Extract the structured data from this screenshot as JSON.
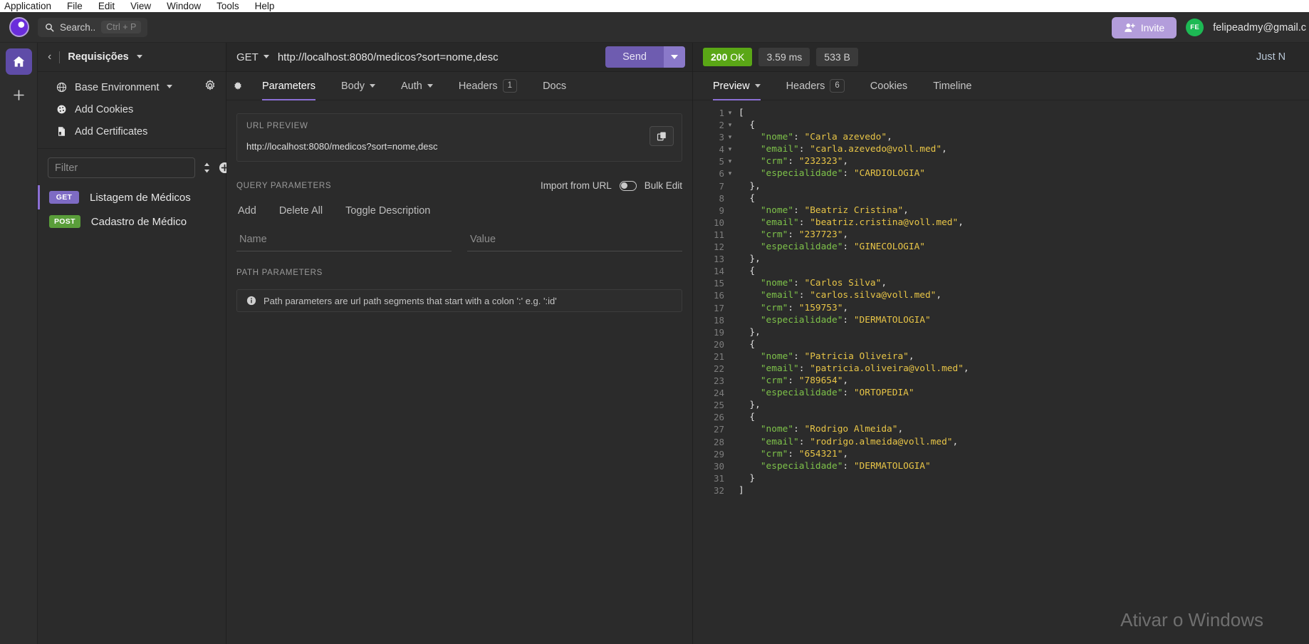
{
  "os_menu": [
    "Application",
    "File",
    "Edit",
    "View",
    "Window",
    "Tools",
    "Help"
  ],
  "header": {
    "logo_name": "insomnia-logo",
    "search": {
      "label": "Search..",
      "shortcut": "Ctrl + P",
      "placeholder": "Search.."
    },
    "invite_label": "Invite",
    "avatar_initials": "FE",
    "account_email": "felipeadmy@gmail.c"
  },
  "activity_bar": [
    {
      "name": "home",
      "icon": "home-icon",
      "active": true
    },
    {
      "name": "add",
      "icon": "plus-icon",
      "active": false
    }
  ],
  "sidebar": {
    "back_label": "‹",
    "title": "Requisições",
    "environment": {
      "label": "Base Environment",
      "settings_icon": "gear-icon"
    },
    "links": [
      {
        "label": "Add Cookies",
        "icon": "cookie-icon"
      },
      {
        "label": "Add Certificates",
        "icon": "certificate-icon"
      }
    ],
    "filter_placeholder": "Filter",
    "filter_value": "",
    "sort_icon": "sort-icon",
    "add_icon": "plus-circle-icon",
    "requests": [
      {
        "method": "GET",
        "name": "Listagem de Médicos",
        "selected": true
      },
      {
        "method": "POST",
        "name": "Cadastro de Médico",
        "selected": false
      }
    ]
  },
  "request": {
    "method": "GET",
    "url": "http://localhost:8080/medicos?sort=nome,desc",
    "send_label": "Send",
    "tabs": [
      {
        "label": "Parameters",
        "active": true,
        "caret": false,
        "badge": null
      },
      {
        "label": "Body",
        "active": false,
        "caret": true,
        "badge": null
      },
      {
        "label": "Auth",
        "active": false,
        "caret": true,
        "badge": null
      },
      {
        "label": "Headers",
        "active": false,
        "caret": false,
        "badge": "1"
      },
      {
        "label": "Docs",
        "active": false,
        "caret": false,
        "badge": null
      }
    ],
    "url_preview": {
      "label": "URL PREVIEW",
      "value": "http://localhost:8080/medicos?sort=nome,desc",
      "copy_icon": "copy-icon"
    },
    "query_parameters": {
      "title": "QUERY PARAMETERS",
      "import_label": "Import from URL",
      "bulk_edit_label": "Bulk Edit",
      "actions": [
        "Add",
        "Delete All",
        "Toggle Description"
      ],
      "name_placeholder": "Name",
      "name_value": "",
      "value_placeholder": "Value",
      "value_value": ""
    },
    "path_parameters": {
      "title": "PATH PARAMETERS",
      "info": "Path parameters are url path segments that start with a colon ':' e.g. ':id'"
    }
  },
  "response": {
    "status_code": "200",
    "status_text": "OK",
    "time": "3.59 ms",
    "size": "533 B",
    "timestamp": "Just N",
    "tabs": [
      {
        "label": "Preview",
        "active": true,
        "caret": true,
        "badge": null
      },
      {
        "label": "Headers",
        "active": false,
        "caret": false,
        "badge": "6"
      },
      {
        "label": "Cookies",
        "active": false,
        "caret": false,
        "badge": null
      },
      {
        "label": "Timeline",
        "active": false,
        "caret": false,
        "badge": null
      }
    ],
    "body": [
      {
        "n": 1,
        "fold": true,
        "indent": 0,
        "text": "["
      },
      {
        "n": 2,
        "fold": true,
        "indent": 1,
        "text": "{"
      },
      {
        "n": 3,
        "fold": false,
        "indent": 2,
        "key": "nome",
        "value": "\"Carla azevedo\"",
        "comma": true
      },
      {
        "n": 4,
        "fold": false,
        "indent": 2,
        "key": "email",
        "value": "\"carla.azevedo@voll.med\"",
        "comma": true
      },
      {
        "n": 5,
        "fold": false,
        "indent": 2,
        "key": "crm",
        "value": "\"232323\"",
        "comma": true
      },
      {
        "n": 6,
        "fold": false,
        "indent": 2,
        "key": "especialidade",
        "value": "\"CARDIOLOGIA\"",
        "comma": false
      },
      {
        "n": 7,
        "fold": false,
        "indent": 1,
        "text": "},"
      },
      {
        "n": 8,
        "fold": true,
        "indent": 1,
        "text": "{"
      },
      {
        "n": 9,
        "fold": false,
        "indent": 2,
        "key": "nome",
        "value": "\"Beatriz Cristina\"",
        "comma": true
      },
      {
        "n": 10,
        "fold": false,
        "indent": 2,
        "key": "email",
        "value": "\"beatriz.cristina@voll.med\"",
        "comma": true
      },
      {
        "n": 11,
        "fold": false,
        "indent": 2,
        "key": "crm",
        "value": "\"237723\"",
        "comma": true
      },
      {
        "n": 12,
        "fold": false,
        "indent": 2,
        "key": "especialidade",
        "value": "\"GINECOLOGIA\"",
        "comma": false
      },
      {
        "n": 13,
        "fold": false,
        "indent": 1,
        "text": "},"
      },
      {
        "n": 14,
        "fold": true,
        "indent": 1,
        "text": "{"
      },
      {
        "n": 15,
        "fold": false,
        "indent": 2,
        "key": "nome",
        "value": "\"Carlos Silva\"",
        "comma": true
      },
      {
        "n": 16,
        "fold": false,
        "indent": 2,
        "key": "email",
        "value": "\"carlos.silva@voll.med\"",
        "comma": true
      },
      {
        "n": 17,
        "fold": false,
        "indent": 2,
        "key": "crm",
        "value": "\"159753\"",
        "comma": true
      },
      {
        "n": 18,
        "fold": false,
        "indent": 2,
        "key": "especialidade",
        "value": "\"DERMATOLOGIA\"",
        "comma": false
      },
      {
        "n": 19,
        "fold": false,
        "indent": 1,
        "text": "},"
      },
      {
        "n": 20,
        "fold": true,
        "indent": 1,
        "text": "{"
      },
      {
        "n": 21,
        "fold": false,
        "indent": 2,
        "key": "nome",
        "value": "\"Patricia Oliveira\"",
        "comma": true
      },
      {
        "n": 22,
        "fold": false,
        "indent": 2,
        "key": "email",
        "value": "\"patricia.oliveira@voll.med\"",
        "comma": true
      },
      {
        "n": 23,
        "fold": false,
        "indent": 2,
        "key": "crm",
        "value": "\"789654\"",
        "comma": true
      },
      {
        "n": 24,
        "fold": false,
        "indent": 2,
        "key": "especialidade",
        "value": "\"ORTOPEDIA\"",
        "comma": false
      },
      {
        "n": 25,
        "fold": false,
        "indent": 1,
        "text": "},"
      },
      {
        "n": 26,
        "fold": true,
        "indent": 1,
        "text": "{"
      },
      {
        "n": 27,
        "fold": false,
        "indent": 2,
        "key": "nome",
        "value": "\"Rodrigo Almeida\"",
        "comma": true
      },
      {
        "n": 28,
        "fold": false,
        "indent": 2,
        "key": "email",
        "value": "\"rodrigo.almeida@voll.med\"",
        "comma": true
      },
      {
        "n": 29,
        "fold": false,
        "indent": 2,
        "key": "crm",
        "value": "\"654321\"",
        "comma": true
      },
      {
        "n": 30,
        "fold": false,
        "indent": 2,
        "key": "especialidade",
        "value": "\"DERMATOLOGIA\"",
        "comma": false
      },
      {
        "n": 31,
        "fold": false,
        "indent": 1,
        "text": "}"
      },
      {
        "n": 32,
        "fold": false,
        "indent": 0,
        "text": "]"
      }
    ]
  },
  "watermark": "Ativar o Windows",
  "colors": {
    "accent": "#8b6fd4",
    "invite": "#b39ddb",
    "send": "#6e5cb0",
    "status_ok": "#5aa716",
    "get": "#7e6bc4",
    "post": "#5a9e3a",
    "avatar": "#1db954",
    "json_key": "#7ec24a",
    "json_string": "#e8c547"
  }
}
